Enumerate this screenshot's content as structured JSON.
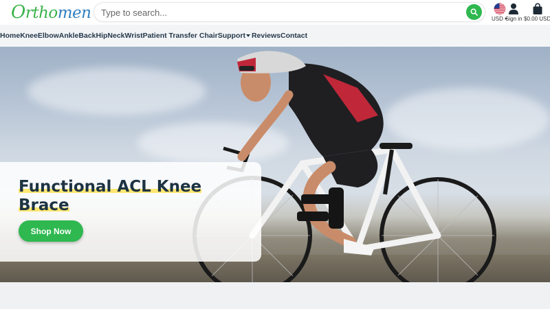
{
  "logo": {
    "first": "O",
    "middle": "rtho",
    "last": "men",
    "alt": "Orthomen"
  },
  "search": {
    "placeholder": "Type to search...",
    "value": ""
  },
  "header": {
    "currency_label": "USD",
    "signin_label": "Sign in",
    "cart_label": "$0.00 USD"
  },
  "nav": {
    "items": [
      "Home",
      "Knee",
      "Elbow",
      "Ankle",
      "Back",
      "Hip",
      "Neck",
      "Wrist",
      "Patient Transfer Chair",
      "Support",
      "Reviews",
      "Contact"
    ]
  },
  "hero": {
    "title": "Functional ACL Knee Brace",
    "cta_label": "Shop Now"
  },
  "colors": {
    "brand_green": "#2eb84f",
    "brand_blue": "#2f7fbf",
    "heading": "#1d3342",
    "highlight": "#ffd600"
  },
  "icons": {
    "search_button": "search-icon",
    "currency": "us-flag-icon",
    "account": "user-icon",
    "cart": "shopping-bag-icon",
    "dropdown": "chevron-down-icon"
  }
}
